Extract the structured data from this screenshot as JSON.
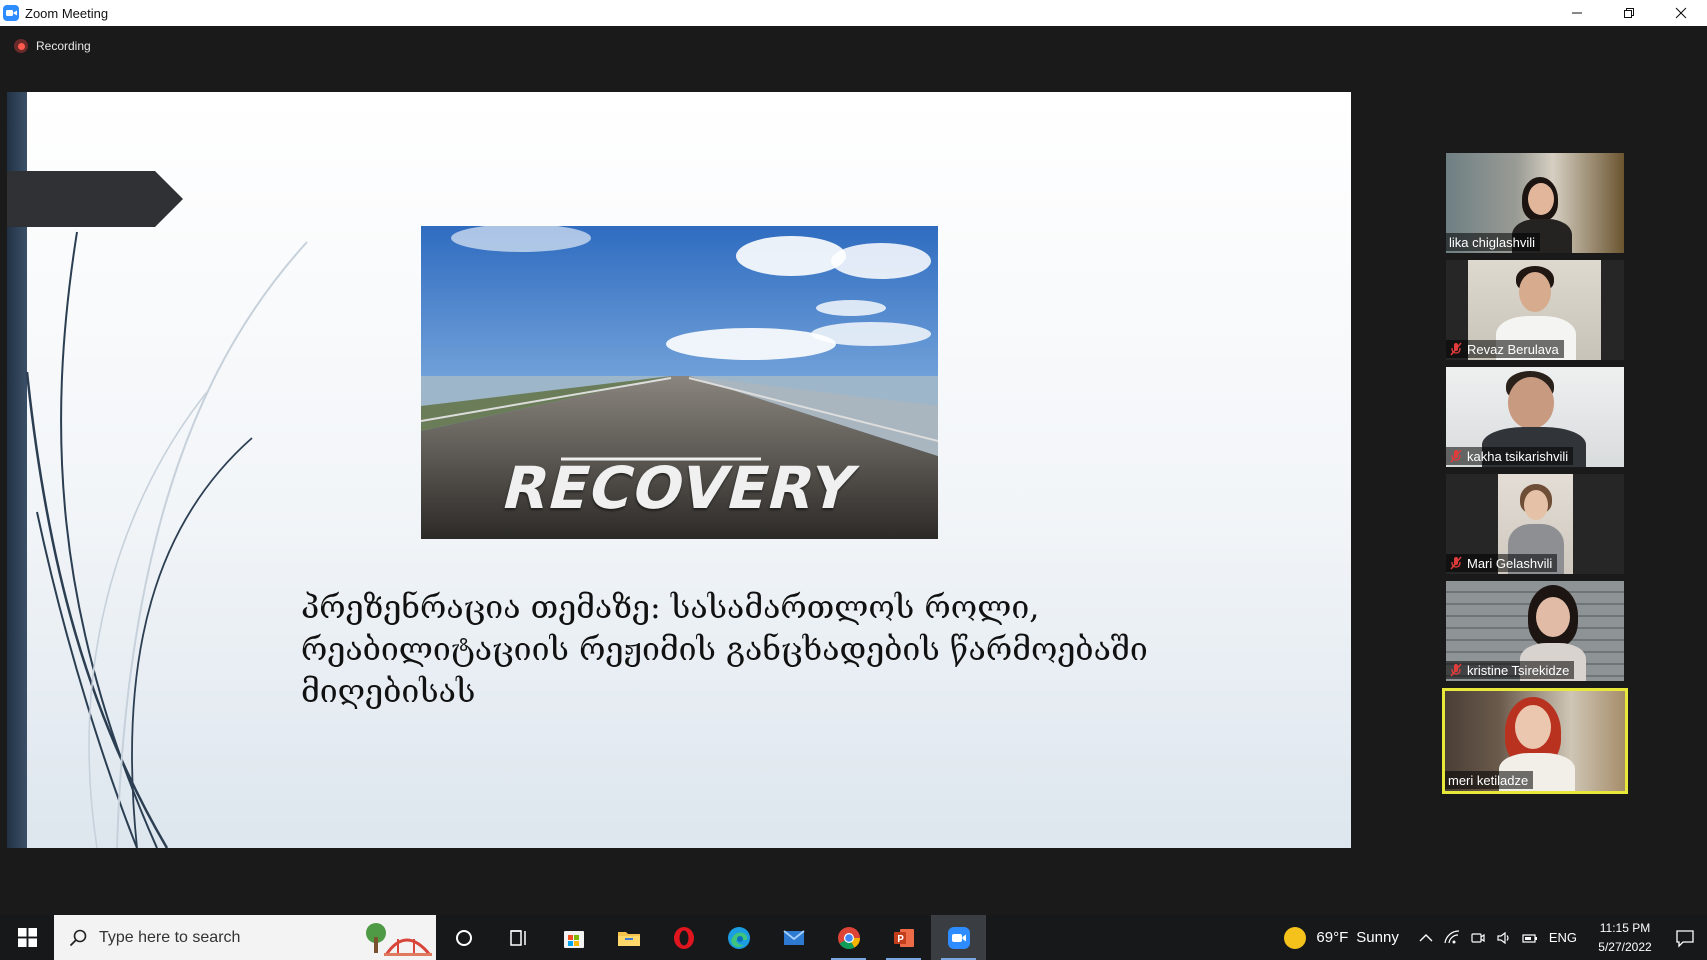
{
  "window": {
    "title": "Zoom Meeting"
  },
  "recording": {
    "label": "Recording"
  },
  "slide": {
    "photo_word": "RECOVERY",
    "caption": "პრეზენრაცია თემაზე: სასამართლოს როლი, რეაბილიტაციის რეჟიმის განცხადების წარმოებაში მიღებისას"
  },
  "participants": [
    {
      "name": "lika chiglashvili",
      "muted": false,
      "active": false
    },
    {
      "name": "Revaz Berulava",
      "muted": true,
      "active": false
    },
    {
      "name": "kakha tsikarishvili",
      "muted": true,
      "active": false
    },
    {
      "name": "Mari Gelashvili",
      "muted": true,
      "active": false
    },
    {
      "name": "kristine Tsirekidze",
      "muted": true,
      "active": false
    },
    {
      "name": "meri ketiladze",
      "muted": false,
      "active": true
    }
  ],
  "taskbar": {
    "search_placeholder": "Type here to search",
    "apps": [
      "cortana-icon",
      "task-view-icon",
      "microsoft-store-icon",
      "file-explorer-icon",
      "opera-icon",
      "edge-icon",
      "mail-icon",
      "chrome-icon",
      "powerpoint-icon",
      "zoom-icon"
    ],
    "weather": {
      "temp": "69°F",
      "condition": "Sunny"
    },
    "language": "ENG",
    "time": "11:15 PM",
    "date": "5/27/2022"
  },
  "colors": {
    "active_speaker_border": "#e8e83a",
    "recording_dot": "#ff5a4d",
    "zoom_blue": "#2d8cff"
  }
}
